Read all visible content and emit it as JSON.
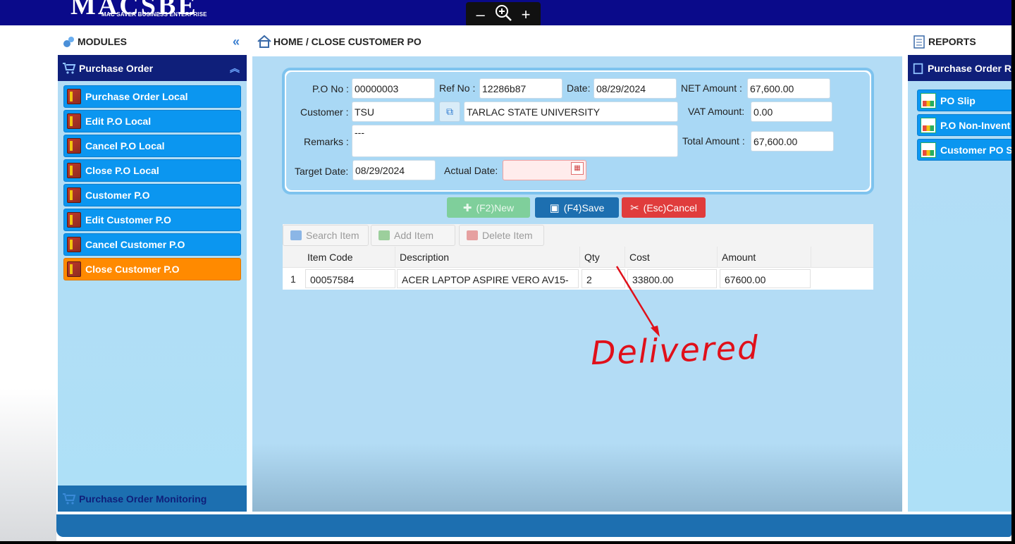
{
  "logo": {
    "name": "MACSBE",
    "tagline": "MAC SAVER BUSINESS ENTERPRISE"
  },
  "zoom": {
    "minus": "–",
    "plus": "+"
  },
  "modules": {
    "title": "MODULES",
    "section": "Purchase Order",
    "items": [
      {
        "label": "Purchase Order Local",
        "active": false
      },
      {
        "label": "Edit P.O Local",
        "active": false
      },
      {
        "label": "Cancel P.O Local",
        "active": false
      },
      {
        "label": "Close P.O Local",
        "active": false
      },
      {
        "label": "Customer P.O",
        "active": false
      },
      {
        "label": "Edit Customer P.O",
        "active": false
      },
      {
        "label": "Cancel Customer P.O",
        "active": false
      },
      {
        "label": "Close Customer P.O",
        "active": true
      }
    ],
    "monitoring": "Purchase Order Monitoring"
  },
  "breadcrumb": "HOME / CLOSE CUSTOMER PO",
  "form": {
    "po_no_label": "P.O No :",
    "po_no": "00000003",
    "ref_no_label": "Ref No :",
    "ref_no": "12286b87",
    "date_label": "Date:",
    "date": "08/29/2024",
    "net_amount_label": "NET Amount :",
    "net_amount": "67,600.00",
    "customer_label": "Customer :",
    "customer_code": "TSU",
    "customer_name": "TARLAC STATE UNIVERSITY",
    "vat_amount_label": "VAT Amount:",
    "vat_amount": "0.00",
    "remarks_label": "Remarks :",
    "remarks": "---",
    "total_amount_label": "Total Amount :",
    "total_amount": "67,600.00",
    "target_date_label": "Target Date:",
    "target_date": "08/29/2024",
    "actual_date_label": "Actual Date:",
    "actual_date": ""
  },
  "actions": {
    "new": "(F2)New",
    "save": "(F4)Save",
    "cancel": "(Esc)Cancel"
  },
  "grid": {
    "toolbar": {
      "search": "Search Item",
      "add": "Add Item",
      "delete": "Delete Item"
    },
    "columns": [
      "Item Code",
      "Description",
      "Qty",
      "Cost",
      "Amount"
    ],
    "rows": [
      {
        "num": "1",
        "item_code": "00057584",
        "description": "ACER LAPTOP ASPIRE VERO AV15-",
        "qty": "2",
        "cost": "33800.00",
        "amount": "67600.00"
      }
    ]
  },
  "annotation": {
    "text": "Delivered",
    "color": "#e0101a"
  },
  "reports": {
    "title": "REPORTS",
    "section": "Purchase Order R",
    "items": [
      "PO Slip",
      "P.O Non-Invent",
      "Customer PO S"
    ]
  }
}
